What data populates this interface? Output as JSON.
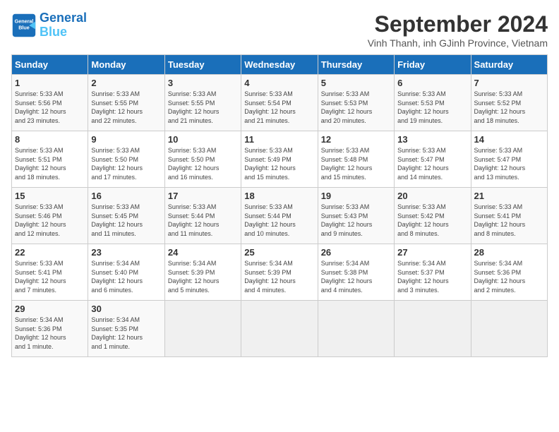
{
  "logo": {
    "name1": "General",
    "name2": "Blue"
  },
  "title": "September 2024",
  "subtitle": "Vinh Thanh, inh GJinh Province, Vietnam",
  "days_of_week": [
    "Sunday",
    "Monday",
    "Tuesday",
    "Wednesday",
    "Thursday",
    "Friday",
    "Saturday"
  ],
  "weeks": [
    [
      {
        "day": "1",
        "text": "Sunrise: 5:33 AM\nSunset: 5:56 PM\nDaylight: 12 hours\nand 23 minutes."
      },
      {
        "day": "2",
        "text": "Sunrise: 5:33 AM\nSunset: 5:55 PM\nDaylight: 12 hours\nand 22 minutes."
      },
      {
        "day": "3",
        "text": "Sunrise: 5:33 AM\nSunset: 5:55 PM\nDaylight: 12 hours\nand 21 minutes."
      },
      {
        "day": "4",
        "text": "Sunrise: 5:33 AM\nSunset: 5:54 PM\nDaylight: 12 hours\nand 21 minutes."
      },
      {
        "day": "5",
        "text": "Sunrise: 5:33 AM\nSunset: 5:53 PM\nDaylight: 12 hours\nand 20 minutes."
      },
      {
        "day": "6",
        "text": "Sunrise: 5:33 AM\nSunset: 5:53 PM\nDaylight: 12 hours\nand 19 minutes."
      },
      {
        "day": "7",
        "text": "Sunrise: 5:33 AM\nSunset: 5:52 PM\nDaylight: 12 hours\nand 18 minutes."
      }
    ],
    [
      {
        "day": "8",
        "text": "Sunrise: 5:33 AM\nSunset: 5:51 PM\nDaylight: 12 hours\nand 18 minutes."
      },
      {
        "day": "9",
        "text": "Sunrise: 5:33 AM\nSunset: 5:50 PM\nDaylight: 12 hours\nand 17 minutes."
      },
      {
        "day": "10",
        "text": "Sunrise: 5:33 AM\nSunset: 5:50 PM\nDaylight: 12 hours\nand 16 minutes."
      },
      {
        "day": "11",
        "text": "Sunrise: 5:33 AM\nSunset: 5:49 PM\nDaylight: 12 hours\nand 15 minutes."
      },
      {
        "day": "12",
        "text": "Sunrise: 5:33 AM\nSunset: 5:48 PM\nDaylight: 12 hours\nand 15 minutes."
      },
      {
        "day": "13",
        "text": "Sunrise: 5:33 AM\nSunset: 5:47 PM\nDaylight: 12 hours\nand 14 minutes."
      },
      {
        "day": "14",
        "text": "Sunrise: 5:33 AM\nSunset: 5:47 PM\nDaylight: 12 hours\nand 13 minutes."
      }
    ],
    [
      {
        "day": "15",
        "text": "Sunrise: 5:33 AM\nSunset: 5:46 PM\nDaylight: 12 hours\nand 12 minutes."
      },
      {
        "day": "16",
        "text": "Sunrise: 5:33 AM\nSunset: 5:45 PM\nDaylight: 12 hours\nand 11 minutes."
      },
      {
        "day": "17",
        "text": "Sunrise: 5:33 AM\nSunset: 5:44 PM\nDaylight: 12 hours\nand 11 minutes."
      },
      {
        "day": "18",
        "text": "Sunrise: 5:33 AM\nSunset: 5:44 PM\nDaylight: 12 hours\nand 10 minutes."
      },
      {
        "day": "19",
        "text": "Sunrise: 5:33 AM\nSunset: 5:43 PM\nDaylight: 12 hours\nand 9 minutes."
      },
      {
        "day": "20",
        "text": "Sunrise: 5:33 AM\nSunset: 5:42 PM\nDaylight: 12 hours\nand 8 minutes."
      },
      {
        "day": "21",
        "text": "Sunrise: 5:33 AM\nSunset: 5:41 PM\nDaylight: 12 hours\nand 8 minutes."
      }
    ],
    [
      {
        "day": "22",
        "text": "Sunrise: 5:33 AM\nSunset: 5:41 PM\nDaylight: 12 hours\nand 7 minutes."
      },
      {
        "day": "23",
        "text": "Sunrise: 5:34 AM\nSunset: 5:40 PM\nDaylight: 12 hours\nand 6 minutes."
      },
      {
        "day": "24",
        "text": "Sunrise: 5:34 AM\nSunset: 5:39 PM\nDaylight: 12 hours\nand 5 minutes."
      },
      {
        "day": "25",
        "text": "Sunrise: 5:34 AM\nSunset: 5:39 PM\nDaylight: 12 hours\nand 4 minutes."
      },
      {
        "day": "26",
        "text": "Sunrise: 5:34 AM\nSunset: 5:38 PM\nDaylight: 12 hours\nand 4 minutes."
      },
      {
        "day": "27",
        "text": "Sunrise: 5:34 AM\nSunset: 5:37 PM\nDaylight: 12 hours\nand 3 minutes."
      },
      {
        "day": "28",
        "text": "Sunrise: 5:34 AM\nSunset: 5:36 PM\nDaylight: 12 hours\nand 2 minutes."
      }
    ],
    [
      {
        "day": "29",
        "text": "Sunrise: 5:34 AM\nSunset: 5:36 PM\nDaylight: 12 hours\nand 1 minute."
      },
      {
        "day": "30",
        "text": "Sunrise: 5:34 AM\nSunset: 5:35 PM\nDaylight: 12 hours\nand 1 minute."
      },
      {
        "day": "",
        "text": ""
      },
      {
        "day": "",
        "text": ""
      },
      {
        "day": "",
        "text": ""
      },
      {
        "day": "",
        "text": ""
      },
      {
        "day": "",
        "text": ""
      }
    ]
  ]
}
